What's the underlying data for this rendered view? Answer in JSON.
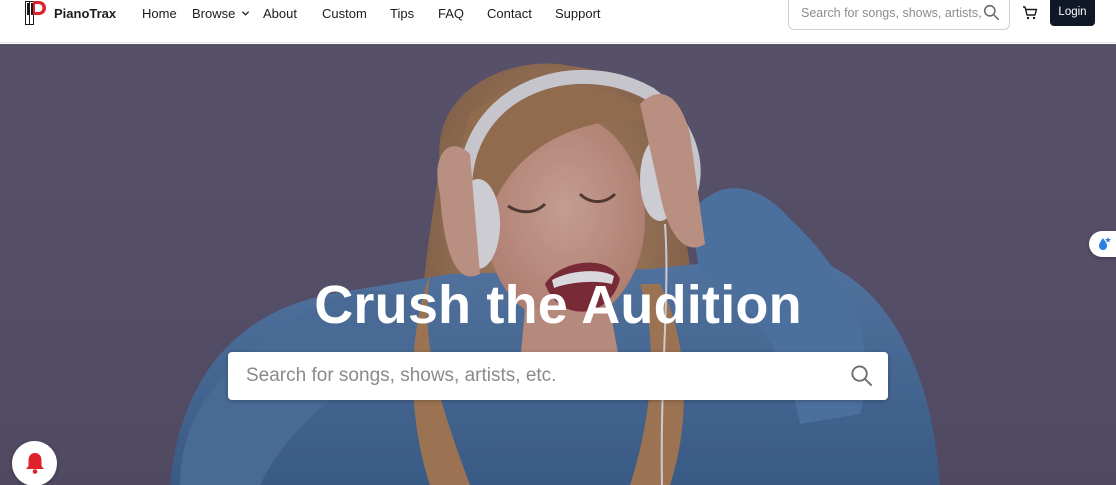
{
  "brand": {
    "name": "PianoTrax",
    "logo_icon": "pianotrax-logo-icon",
    "accent": "#e0202a"
  },
  "nav": {
    "links": [
      "Home",
      "Browse",
      "About",
      "Custom",
      "Tips",
      "FAQ",
      "Contact",
      "Support"
    ],
    "search_placeholder": "Search for songs, shows, artists, etc.",
    "cart_icon": "cart-icon",
    "login_label": "Login"
  },
  "hero": {
    "headline": "Crush the Audition",
    "search_placeholder": "Search for songs, shows, artists, etc.",
    "search_icon": "search-icon",
    "background_color": "#5f5870"
  },
  "widgets": {
    "accessibility_icon": "accessibility-icon",
    "notification_icon": "bell-icon",
    "notification_color": "#e0202a"
  }
}
